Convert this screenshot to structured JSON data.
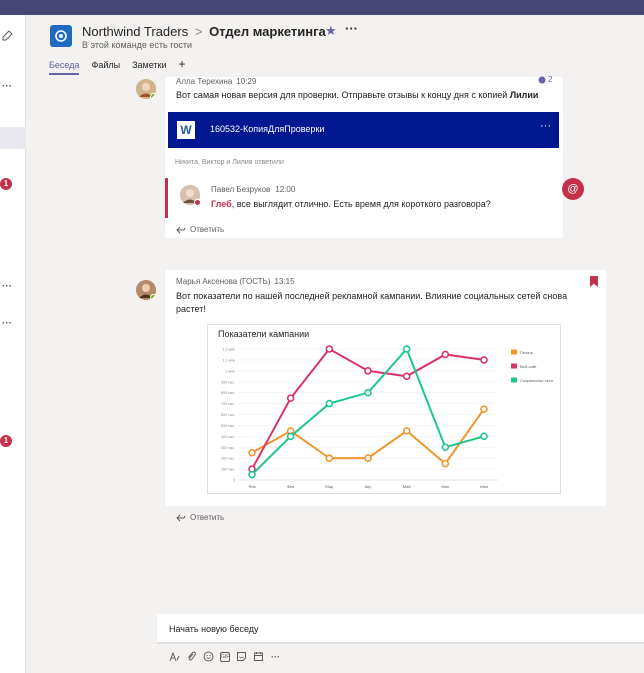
{
  "header": {
    "team_name": "Northwind Traders",
    "separator": ">",
    "channel_name": "Отдел маркетинга",
    "guest_note": "В этой команде есть гости",
    "more": "···"
  },
  "tabs": [
    {
      "label": "Беседа",
      "active": true
    },
    {
      "label": "Файлы",
      "active": false
    },
    {
      "label": "Заметки",
      "active": false
    }
  ],
  "left_rail": {
    "badges": [
      "1",
      "1"
    ],
    "more": "···"
  },
  "messages": [
    {
      "author": "Алла Терехина",
      "time": "10:29",
      "text_prefix": "Вот самая новая версия для проверки. Отправьте отзывы к концу дня с копией ",
      "text_bold": "Лилии",
      "reaction_count": "2",
      "file_name": "160532-КопияДляПроверки",
      "file_more": "···",
      "replied_note": "Никита, Виктор и Лилия ответили",
      "reply": {
        "author": "Павел Безруков",
        "time": "12:00",
        "mention": "Глеб",
        "text": ", все выглядит отлично. Есть время для короткого разговора?"
      },
      "reply_action": "Ответить",
      "mention_bubble": "@"
    },
    {
      "author": "Марья Аксенова (ГОСТЬ)",
      "time": "13:15",
      "text": "Вот показатели по нашей последней рекламной кампании. Влияние социальных сетей снова растет!",
      "reply_action": "Ответить"
    }
  ],
  "chart_data": {
    "type": "line",
    "title": "Показатели кампании",
    "categories": [
      "Янв",
      "Фев",
      "Мар",
      "Апр",
      "Май",
      "Июн",
      "Июл"
    ],
    "ytick_labels": [
      "0",
      "100 тыс.",
      "200 тыс.",
      "300 тыс.",
      "400 тыс.",
      "500 тыс.",
      "600 тыс.",
      "700 тыс.",
      "800 тыс.",
      "900 тыс.",
      "1 млн",
      "1,1 млн",
      "1,2 млн"
    ],
    "ylim": [
      0,
      1200000
    ],
    "legend_position": "right",
    "series": [
      {
        "name": "Печать",
        "color": "#f0962e",
        "values": [
          250000,
          450000,
          200000,
          200000,
          450000,
          150000,
          650000
        ]
      },
      {
        "name": "Веб-сайт",
        "color": "#d9336b",
        "values": [
          100000,
          750000,
          1200000,
          1000000,
          950000,
          1150000,
          1100000
        ]
      },
      {
        "name": "Социальные сети",
        "color": "#22c58b",
        "values": [
          50000,
          400000,
          700000,
          800000,
          1200000,
          300000,
          400000
        ]
      }
    ]
  },
  "compose": {
    "placeholder": "Начать новую беседу"
  },
  "toolbar": {
    "format_icon": "format-icon",
    "attach_icon": "attach-icon",
    "emoji_icon": "emoji-icon",
    "gif_label": "GIF",
    "sticker_icon": "sticker-icon",
    "meeting_icon": "calendar-icon",
    "more": "···"
  },
  "colors": {
    "accent": "#6264a7",
    "topbar": "#464775",
    "mention": "#c4314b",
    "file_card": "#00188f"
  }
}
